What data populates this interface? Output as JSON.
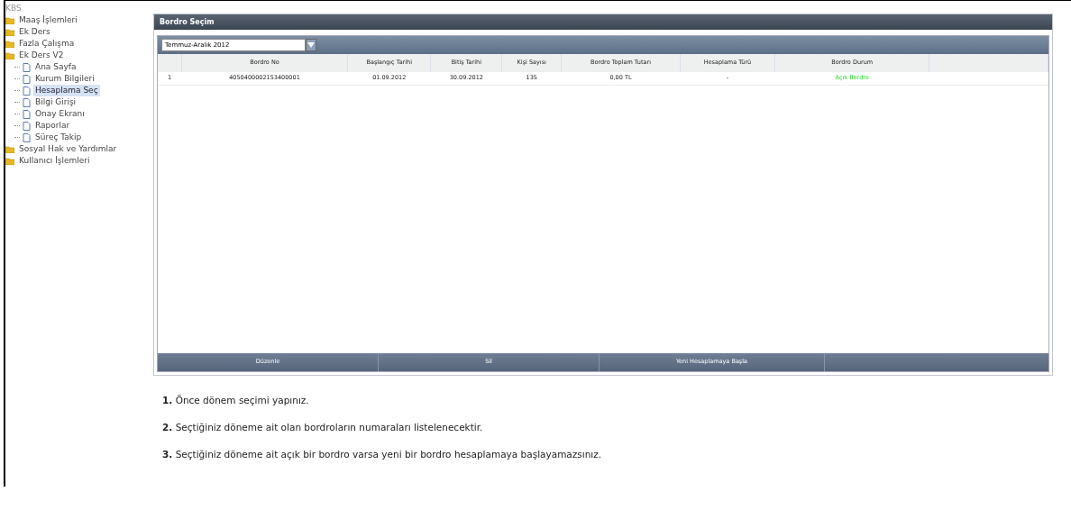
{
  "app_title": "KBS",
  "tree": [
    {
      "label": "Maaş İşlemleri",
      "selected": false
    },
    {
      "label": "Ek Ders",
      "selected": false
    },
    {
      "label": "Fazla Çalışma",
      "selected": false
    },
    {
      "label": "Ek Ders V2",
      "selected": false,
      "children": [
        {
          "label": "Ana Sayfa",
          "selected": false
        },
        {
          "label": "Kurum Bilgileri",
          "selected": false
        },
        {
          "label": "Hesaplama Seç",
          "selected": true
        },
        {
          "label": "Bilgi Girişi",
          "selected": false
        },
        {
          "label": "Onay Ekranı",
          "selected": false
        },
        {
          "label": "Raporlar",
          "selected": false
        },
        {
          "label": "Süreç Takip",
          "selected": false
        }
      ]
    },
    {
      "label": "Sosyal Hak ve Yardımlar",
      "selected": false
    },
    {
      "label": "Kullanıcı İşlemleri",
      "selected": false
    }
  ],
  "panel": {
    "title": "Bordro Seçim",
    "period": "Temmuz-Aralık 2012",
    "table": {
      "columns": [
        "Bordro No",
        "Başlangıç Tarihi",
        "Bitiş Tarihi",
        "Kişi Sayısı",
        "Bordro Toplam Tutarı",
        "Hesaplama Türü",
        "Bordro Durum"
      ],
      "rows": [
        {
          "index": "1",
          "cells": [
            "4050400002153400001",
            "01.09.2012",
            "30.09.2012",
            "135",
            "0,00 TL",
            "-",
            "Açık Bordro"
          ],
          "kind": "open"
        }
      ]
    },
    "buttons": [
      "Düzenle",
      "Sil",
      "Yeni Hesaplamaya Başla"
    ]
  },
  "notes": [
    "**1.** Önce dönem seçimi yapınız.",
    "**2.** Seçtiğiniz döneme ait olan bordroların numaraları listelenecektir.",
    "**3.** Seçtiğiniz döneme ait açık bir bordro varsa yeni bir bordro hesaplamaya başlayamazsınız."
  ]
}
